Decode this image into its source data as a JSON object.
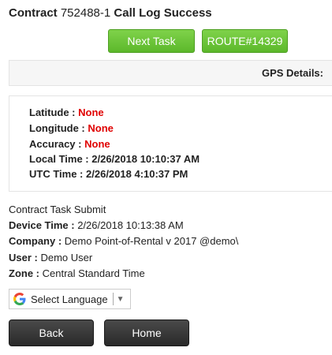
{
  "header": {
    "contract_label": "Contract",
    "contract_number": "752488-1",
    "status": "Call Log Success"
  },
  "buttons": {
    "next_task": "Next Task",
    "route": "ROUTE#14329",
    "back": "Back",
    "home": "Home"
  },
  "gps": {
    "heading": "GPS Details:",
    "latitude_label": "Latitude :",
    "latitude_value": "None",
    "longitude_label": "Longitude :",
    "longitude_value": "None",
    "accuracy_label": "Accuracy :",
    "accuracy_value": "None",
    "local_time_label": "Local Time :",
    "local_time_value": "2/26/2018 10:10:37 AM",
    "utc_time_label": "UTC Time :",
    "utc_time_value": "2/26/2018 4:10:37 PM"
  },
  "submit": {
    "title": "Contract Task Submit",
    "device_time_label": "Device Time :",
    "device_time_value": "2/26/2018 10:13:38 AM",
    "company_label": "Company :",
    "company_value": "Demo Point-of-Rental v 2017 @demo\\",
    "user_label": "User :",
    "user_value": "Demo User",
    "zone_label": "Zone :",
    "zone_value": "Central Standard Time"
  },
  "language": {
    "label": "Select Language",
    "icon": "google-g-icon",
    "arrow_icon": "dropdown-arrow-icon"
  },
  "colors": {
    "green_button": "#6cc43a",
    "dark_button": "#333333",
    "value_red": "#e00000"
  }
}
